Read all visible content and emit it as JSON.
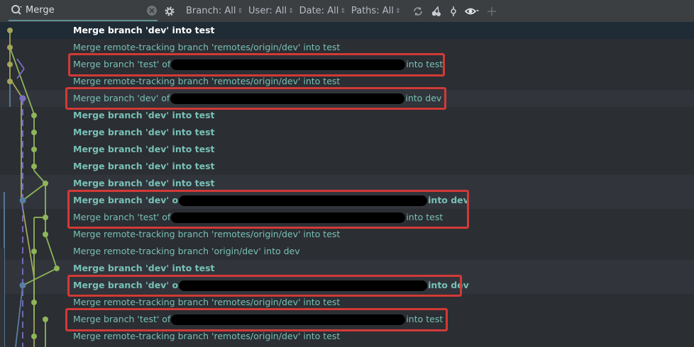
{
  "toolbar": {
    "search_value": "Merge",
    "filters": [
      "Branch: All",
      "User: All",
      "Date: All",
      "Paths: All"
    ]
  },
  "rows": [
    {
      "pre": "Merge branch 'dev' into test",
      "post": "",
      "redact": 0,
      "bold": true,
      "sel": true
    },
    {
      "pre": "Merge remote-tracking branch 'remotes/origin/dev' into test",
      "post": "",
      "redact": 0,
      "bold": false
    },
    {
      "pre": "Merge branch 'test' of",
      "post": "into test",
      "redact": 330,
      "bold": false
    },
    {
      "pre": "Merge remote-tracking branch 'remotes/origin/dev' into test",
      "post": "",
      "redact": 0,
      "bold": false
    },
    {
      "pre": "Merge branch 'dev' of",
      "post": "into dev",
      "redact": 330,
      "bold": false
    },
    {
      "pre": "Merge branch 'dev' into test",
      "post": "",
      "redact": 0,
      "bold": true
    },
    {
      "pre": "Merge branch 'dev' into test",
      "post": "",
      "redact": 0,
      "bold": true
    },
    {
      "pre": "Merge branch 'dev' into test",
      "post": "",
      "redact": 0,
      "bold": true
    },
    {
      "pre": "Merge branch 'dev' into test",
      "post": "",
      "redact": 0,
      "bold": true
    },
    {
      "pre": "Merge branch 'dev' into test",
      "post": "",
      "redact": 0,
      "bold": true
    },
    {
      "pre": "Merge branch 'dev' o",
      "post": "into dev",
      "redact": 350,
      "bold": true
    },
    {
      "pre": "Merge branch 'test' of",
      "post": "into test",
      "redact": 330,
      "bold": false
    },
    {
      "pre": "Merge remote-tracking branch 'remotes/origin/dev' into test",
      "post": "",
      "redact": 0,
      "bold": false
    },
    {
      "pre": "Merge remote-tracking branch 'origin/dev' into dev",
      "post": "",
      "redact": 0,
      "bold": false
    },
    {
      "pre": "Merge branch 'dev' into test",
      "post": "",
      "redact": 0,
      "bold": true
    },
    {
      "pre": "Merge branch 'dev' o",
      "post": "into dev",
      "redact": 350,
      "bold": true
    },
    {
      "pre": "Merge remote-tracking branch 'remotes/origin/dev' into test",
      "post": "",
      "redact": 0,
      "bold": false
    },
    {
      "pre": "Merge branch 'test' of",
      "post": "into test",
      "redact": 330,
      "bold": false
    },
    {
      "pre": "Merge remote-tracking branch 'remotes/origin/dev' into test",
      "post": "",
      "redact": 0,
      "bold": false
    }
  ],
  "colors": {
    "commit_text": "#78c0b6",
    "highlight": "#d13a37",
    "graph_green": "#8fb55a",
    "graph_olive": "#a3a55a",
    "graph_purple": "#7b6fc4",
    "graph_blue": "#5a7ea0"
  },
  "icons": [
    "search-icon",
    "clear-icon",
    "gear-icon",
    "refresh-icon",
    "cherry-pick-icon",
    "commit-icon",
    "eye-icon",
    "plus-icon"
  ]
}
